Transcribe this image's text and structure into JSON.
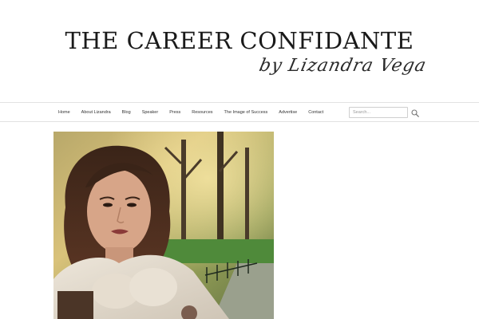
{
  "header": {
    "title": "THE CAREER CONFIDANTE",
    "tagline": "by Lizandra Vega"
  },
  "nav": {
    "items": [
      "Home",
      "About Lizandra",
      "Blog",
      "Speaker",
      "Press",
      "Resources",
      "The Image of Success",
      "Advertise",
      "Contact"
    ]
  },
  "search": {
    "placeholder": "Search...",
    "value": ""
  },
  "icons": {
    "search": "search-icon"
  },
  "colors": {
    "text": "#1a1a1a",
    "border": "#e2e2e2",
    "background": "#ffffff"
  }
}
